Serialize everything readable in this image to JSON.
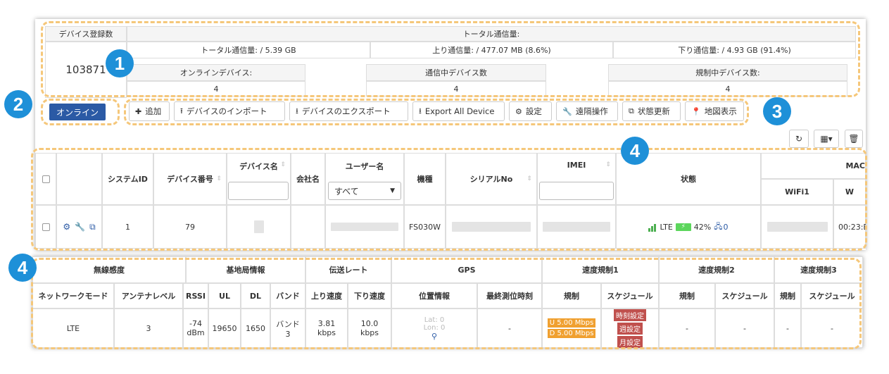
{
  "summary": {
    "device_count_label": "デバイス登録数",
    "device_count": "103871",
    "total_label": "トータル通信量:",
    "total_traffic": "トータル通信量: / 5.39 GB",
    "up_traffic": "上り通信量: / 477.07 MB (8.6%)",
    "down_traffic": "下り通信量: / 4.93 GB (91.4%)",
    "online_label": "オンラインデバイス:",
    "online_value": "4",
    "comm_label": "通信中デバイス数",
    "comm_value": "4",
    "restrict_label": "規制中デバイス数:",
    "restrict_value": "4"
  },
  "filter": {
    "online": "オンライン"
  },
  "toolbar": {
    "add": "追加",
    "import": "デバイスのインポート",
    "export": "デバイスのエクスポート",
    "export_all": "Export All Device",
    "settings": "設定",
    "remote": "遠隔操作",
    "refresh_status": "状態更新",
    "map": "地図表示"
  },
  "badges": [
    "1",
    "2",
    "3",
    "4",
    "4"
  ],
  "table1": {
    "headers": {
      "system_id": "システムID",
      "device_no": "デバイス番号",
      "device_name": "デバイス名",
      "company": "会社名",
      "user_name": "ユーザー名",
      "model": "機種",
      "serial": "シリアルNo",
      "imei": "IMEI",
      "status": "状態",
      "mac": "MAC",
      "wifi1": "WiFi1",
      "w_partial": "W"
    },
    "user_select": "すべて",
    "row": {
      "system_id": "1",
      "device_no": "79",
      "model": "FS030W",
      "network": "LTE",
      "battery": "42%",
      "clients": "0",
      "mac_partial": "00:23:E"
    }
  },
  "table2": {
    "groups": {
      "radio": "無線感度",
      "base": "基地局情報",
      "rate": "伝送レート",
      "gps": "GPS",
      "limit1": "速度規制1",
      "limit2": "速度規制2",
      "limit3": "速度規制3"
    },
    "headers": {
      "network_mode": "ネットワークモード",
      "antenna": "アンテナレベル",
      "rssi": "RSSI",
      "ul": "UL",
      "dl": "DL",
      "band": "バンド",
      "up_speed": "上り速度",
      "down_speed": "下り速度",
      "location": "位置情報",
      "last_time": "最終測位時刻",
      "limit": "規制",
      "schedule": "スケジュール"
    },
    "row": {
      "network_mode": "LTE",
      "antenna": "3",
      "rssi_a": "-74",
      "rssi_b": "dBm",
      "ul": "19650",
      "dl": "1650",
      "band_a": "バンド",
      "band_b": "3",
      "up_a": "3.81",
      "up_b": "kbps",
      "down_a": "10.0",
      "down_b": "kbps",
      "lat": "Lat: 0",
      "lon": "Lon: 0",
      "last_time": "-",
      "limit_up": "U 5.00 Mbps",
      "limit_down": "D 5.00 Mbps",
      "sched_time": "時刻設定",
      "sched_week": "週設定",
      "sched_month": "月設定",
      "dash": "-"
    }
  },
  "colors": {
    "primary": "#2b5aa5",
    "badge": "#1e90d8",
    "highlight": "#f5c77a",
    "limit_tag": "#f0a030",
    "sched_tag": "#c0504d",
    "battery": "#5cd65c"
  }
}
